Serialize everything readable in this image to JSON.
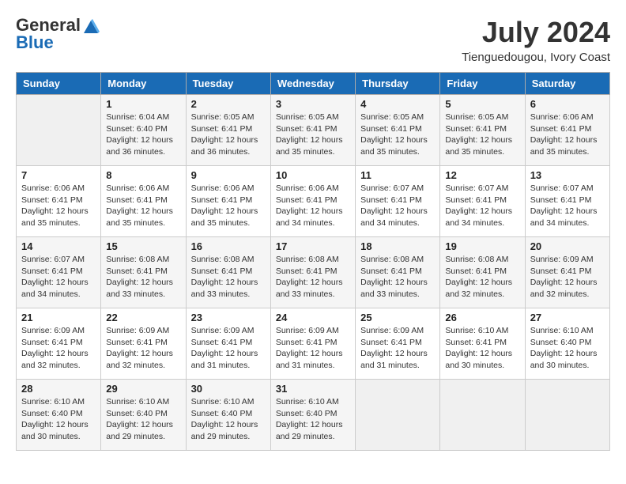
{
  "header": {
    "logo_line1": "General",
    "logo_line2": "Blue",
    "month": "July 2024",
    "location": "Tienguedougou, Ivory Coast"
  },
  "weekdays": [
    "Sunday",
    "Monday",
    "Tuesday",
    "Wednesday",
    "Thursday",
    "Friday",
    "Saturday"
  ],
  "weeks": [
    [
      {
        "day": "",
        "info": ""
      },
      {
        "day": "1",
        "info": "Sunrise: 6:04 AM\nSunset: 6:40 PM\nDaylight: 12 hours\nand 36 minutes."
      },
      {
        "day": "2",
        "info": "Sunrise: 6:05 AM\nSunset: 6:41 PM\nDaylight: 12 hours\nand 36 minutes."
      },
      {
        "day": "3",
        "info": "Sunrise: 6:05 AM\nSunset: 6:41 PM\nDaylight: 12 hours\nand 35 minutes."
      },
      {
        "day": "4",
        "info": "Sunrise: 6:05 AM\nSunset: 6:41 PM\nDaylight: 12 hours\nand 35 minutes."
      },
      {
        "day": "5",
        "info": "Sunrise: 6:05 AM\nSunset: 6:41 PM\nDaylight: 12 hours\nand 35 minutes."
      },
      {
        "day": "6",
        "info": "Sunrise: 6:06 AM\nSunset: 6:41 PM\nDaylight: 12 hours\nand 35 minutes."
      }
    ],
    [
      {
        "day": "7",
        "info": "Sunrise: 6:06 AM\nSunset: 6:41 PM\nDaylight: 12 hours\nand 35 minutes."
      },
      {
        "day": "8",
        "info": "Sunrise: 6:06 AM\nSunset: 6:41 PM\nDaylight: 12 hours\nand 35 minutes."
      },
      {
        "day": "9",
        "info": "Sunrise: 6:06 AM\nSunset: 6:41 PM\nDaylight: 12 hours\nand 35 minutes."
      },
      {
        "day": "10",
        "info": "Sunrise: 6:06 AM\nSunset: 6:41 PM\nDaylight: 12 hours\nand 34 minutes."
      },
      {
        "day": "11",
        "info": "Sunrise: 6:07 AM\nSunset: 6:41 PM\nDaylight: 12 hours\nand 34 minutes."
      },
      {
        "day": "12",
        "info": "Sunrise: 6:07 AM\nSunset: 6:41 PM\nDaylight: 12 hours\nand 34 minutes."
      },
      {
        "day": "13",
        "info": "Sunrise: 6:07 AM\nSunset: 6:41 PM\nDaylight: 12 hours\nand 34 minutes."
      }
    ],
    [
      {
        "day": "14",
        "info": "Sunrise: 6:07 AM\nSunset: 6:41 PM\nDaylight: 12 hours\nand 34 minutes."
      },
      {
        "day": "15",
        "info": "Sunrise: 6:08 AM\nSunset: 6:41 PM\nDaylight: 12 hours\nand 33 minutes."
      },
      {
        "day": "16",
        "info": "Sunrise: 6:08 AM\nSunset: 6:41 PM\nDaylight: 12 hours\nand 33 minutes."
      },
      {
        "day": "17",
        "info": "Sunrise: 6:08 AM\nSunset: 6:41 PM\nDaylight: 12 hours\nand 33 minutes."
      },
      {
        "day": "18",
        "info": "Sunrise: 6:08 AM\nSunset: 6:41 PM\nDaylight: 12 hours\nand 33 minutes."
      },
      {
        "day": "19",
        "info": "Sunrise: 6:08 AM\nSunset: 6:41 PM\nDaylight: 12 hours\nand 32 minutes."
      },
      {
        "day": "20",
        "info": "Sunrise: 6:09 AM\nSunset: 6:41 PM\nDaylight: 12 hours\nand 32 minutes."
      }
    ],
    [
      {
        "day": "21",
        "info": "Sunrise: 6:09 AM\nSunset: 6:41 PM\nDaylight: 12 hours\nand 32 minutes."
      },
      {
        "day": "22",
        "info": "Sunrise: 6:09 AM\nSunset: 6:41 PM\nDaylight: 12 hours\nand 32 minutes."
      },
      {
        "day": "23",
        "info": "Sunrise: 6:09 AM\nSunset: 6:41 PM\nDaylight: 12 hours\nand 31 minutes."
      },
      {
        "day": "24",
        "info": "Sunrise: 6:09 AM\nSunset: 6:41 PM\nDaylight: 12 hours\nand 31 minutes."
      },
      {
        "day": "25",
        "info": "Sunrise: 6:09 AM\nSunset: 6:41 PM\nDaylight: 12 hours\nand 31 minutes."
      },
      {
        "day": "26",
        "info": "Sunrise: 6:10 AM\nSunset: 6:41 PM\nDaylight: 12 hours\nand 30 minutes."
      },
      {
        "day": "27",
        "info": "Sunrise: 6:10 AM\nSunset: 6:40 PM\nDaylight: 12 hours\nand 30 minutes."
      }
    ],
    [
      {
        "day": "28",
        "info": "Sunrise: 6:10 AM\nSunset: 6:40 PM\nDaylight: 12 hours\nand 30 minutes."
      },
      {
        "day": "29",
        "info": "Sunrise: 6:10 AM\nSunset: 6:40 PM\nDaylight: 12 hours\nand 29 minutes."
      },
      {
        "day": "30",
        "info": "Sunrise: 6:10 AM\nSunset: 6:40 PM\nDaylight: 12 hours\nand 29 minutes."
      },
      {
        "day": "31",
        "info": "Sunrise: 6:10 AM\nSunset: 6:40 PM\nDaylight: 12 hours\nand 29 minutes."
      },
      {
        "day": "",
        "info": ""
      },
      {
        "day": "",
        "info": ""
      },
      {
        "day": "",
        "info": ""
      }
    ]
  ]
}
